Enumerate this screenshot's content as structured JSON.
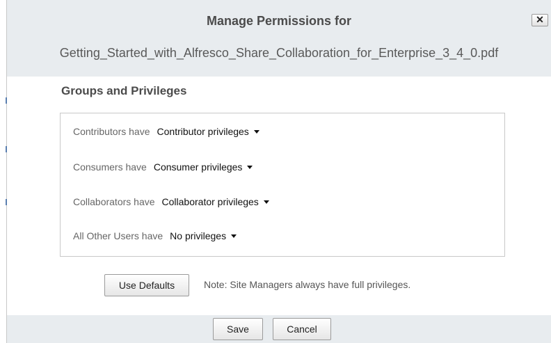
{
  "dialog": {
    "title_line1": "Manage Permissions for",
    "title_line2": "Getting_Started_with_Alfresco_Share_Collaboration_for_Enterprise_3_4_0.pdf",
    "close_label": "✕"
  },
  "groups": {
    "heading": "Groups and Privileges",
    "rows": [
      {
        "label": "Contributors have",
        "value": "Contributor privileges"
      },
      {
        "label": "Consumers have",
        "value": "Consumer privileges"
      },
      {
        "label": "Collaborators have",
        "value": "Collaborator privileges"
      },
      {
        "label": "All Other Users have",
        "value": "No privileges"
      }
    ]
  },
  "defaults": {
    "button_label": "Use Defaults",
    "note": "Note: Site Managers always have full privileges."
  },
  "footer": {
    "save_label": "Save",
    "cancel_label": "Cancel"
  },
  "colors": {
    "header_bg": "#e8ecef",
    "text": "#333333"
  }
}
